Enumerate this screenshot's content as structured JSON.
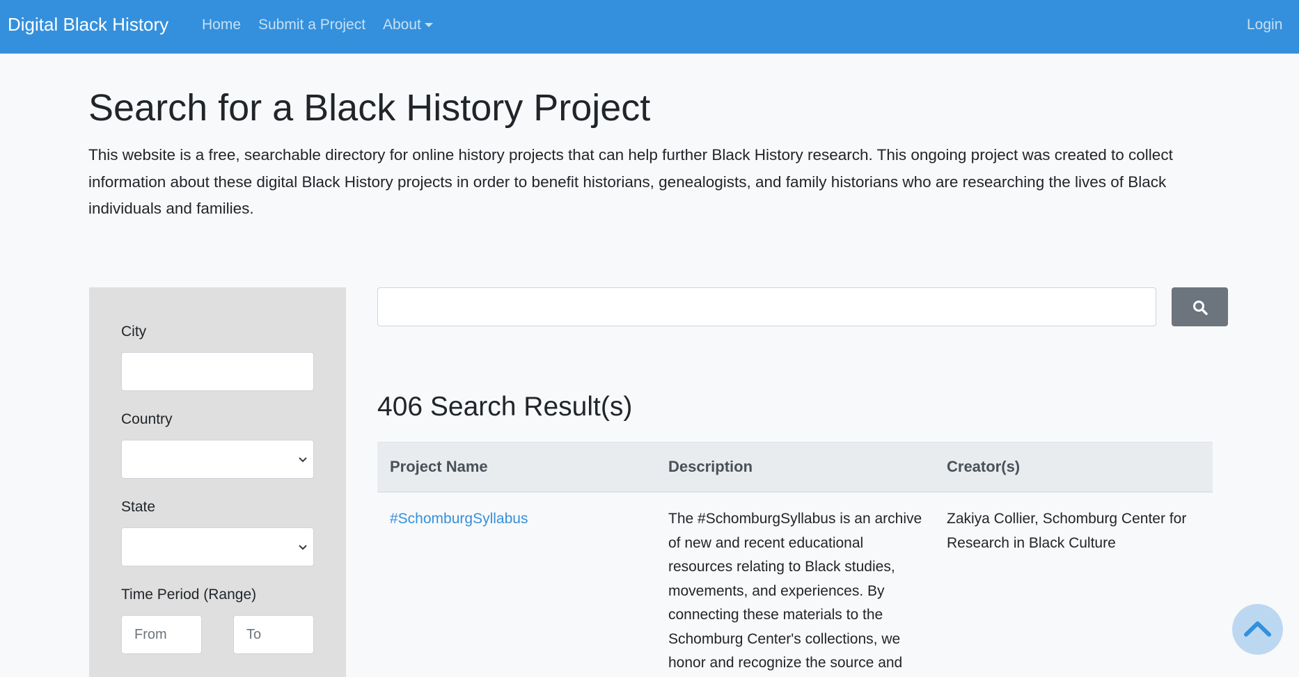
{
  "navbar": {
    "brand": "Digital Black History",
    "links": [
      "Home",
      "Submit a Project",
      "About"
    ],
    "login": "Login"
  },
  "main": {
    "title": "Search for a Black History Project",
    "intro": "This website is a free, searchable directory for online history projects that can help further Black History research. This ongoing project was created to collect information about these digital Black History projects in order to benefit historians, genealogists, and family historians who are researching the lives of Black individuals and families."
  },
  "filters": {
    "city_label": "City",
    "country_label": "Country",
    "state_label": "State",
    "time_period_label": "Time Period (Range)",
    "from_placeholder": "From",
    "to_placeholder": "To"
  },
  "search": {
    "placeholder": "",
    "button_icon": "search-icon"
  },
  "results": {
    "heading": "406 Search Result(s)",
    "columns": [
      "Project Name",
      "Description",
      "Creator(s)"
    ],
    "rows": [
      {
        "name": "#SchomburgSyllabus",
        "description": "The #SchomburgSyllabus is an archive of new and recent educational resources relating to Black studies, movements, and experiences. By connecting these materials to the Schomburg Center's collections, we honor and recognize the source and",
        "creators": "Zakiya Collier, Schomburg Center for Research in Black Culture"
      }
    ]
  },
  "colors": {
    "navbar": "#3490dc",
    "link": "#3490dc",
    "search_button": "#6c757d",
    "sidebar": "#dfdfdf"
  },
  "back_to_top_icon": "chevron-up-icon"
}
